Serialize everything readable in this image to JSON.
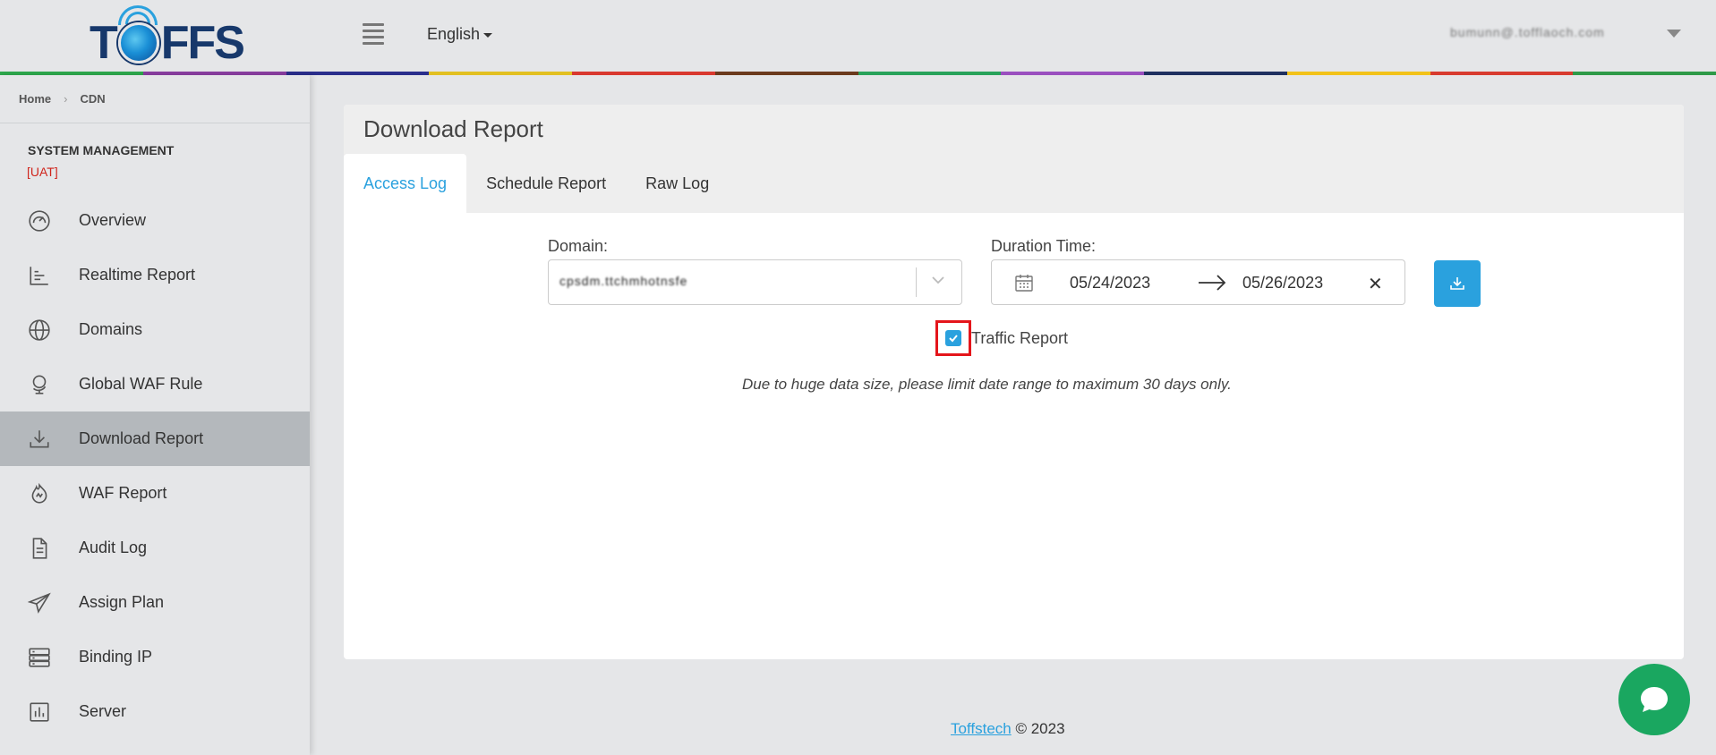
{
  "brand": {
    "logo_text_left": "T",
    "logo_text_right": "FFS"
  },
  "header": {
    "language": "English",
    "user": "bumunn@.tofflaoch.com"
  },
  "stripe_colors": [
    "#2ea84d",
    "#8a3ea0",
    "#2a2e8c",
    "#e2c021",
    "#d9392f",
    "#6b3a1d",
    "#29a35b",
    "#9a4fbf",
    "#1f3060",
    "#f2c21a",
    "#d83b2f",
    "#2e9a48"
  ],
  "breadcrumb": {
    "home": "Home",
    "current": "CDN"
  },
  "sidebar": {
    "section_title": "SYSTEM MANAGEMENT",
    "env_tag": "[UAT]",
    "items": [
      {
        "label": "Overview",
        "icon": "gauge-icon"
      },
      {
        "label": "Realtime Report",
        "icon": "bar-chart-icon"
      },
      {
        "label": "Domains",
        "icon": "globe-icon"
      },
      {
        "label": "Global WAF Rule",
        "icon": "globe-stand-icon"
      },
      {
        "label": "Download Report",
        "icon": "download-icon"
      },
      {
        "label": "WAF Report",
        "icon": "fire-icon"
      },
      {
        "label": "Audit Log",
        "icon": "document-icon"
      },
      {
        "label": "Assign Plan",
        "icon": "paper-plane-icon"
      },
      {
        "label": "Binding IP",
        "icon": "server-stack-icon"
      },
      {
        "label": "Server",
        "icon": "chart-box-icon"
      }
    ]
  },
  "page": {
    "title": "Download Report",
    "tabs": [
      "Access Log",
      "Schedule Report",
      "Raw Log"
    ],
    "domain_label": "Domain:",
    "domain_value": "cpsdm.ttchmhotnsfe",
    "duration_label": "Duration Time:",
    "date_start": "05/24/2023",
    "date_end": "05/26/2023",
    "traffic_report_label": "Traffic Report",
    "traffic_report_checked": true,
    "note": "Due to huge data size, please limit date range to maximum 30 days only."
  },
  "footer": {
    "link": "Toffstech",
    "suffix": " © 2023"
  },
  "colors": {
    "accent": "#2aa1de",
    "alert": "#d0241b",
    "chat": "#1aa760"
  }
}
